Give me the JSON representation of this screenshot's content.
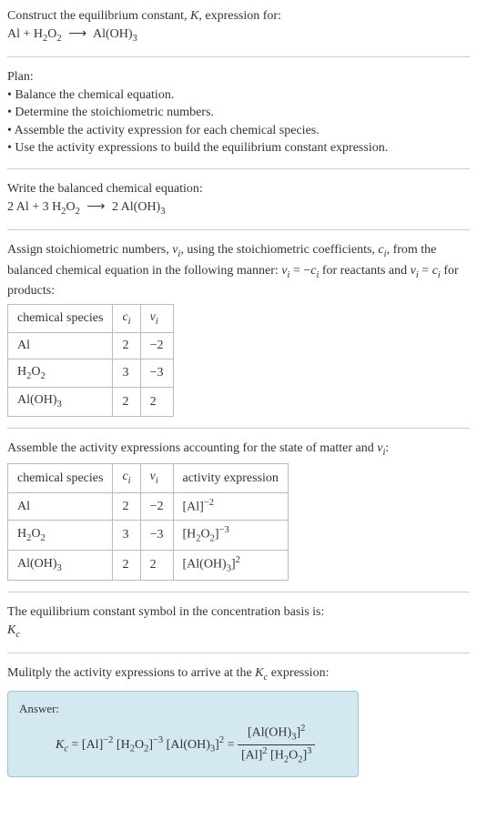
{
  "intro": {
    "line1": "Construct the equilibrium constant, ",
    "K": "K",
    "line1b": ", expression for:",
    "equation_lhs": "Al + H",
    "equation_sub1": "2",
    "equation_mid": "O",
    "equation_sub2": "2",
    "arrow": "⟶",
    "equation_rhs": "Al(OH)",
    "equation_sub3": "3"
  },
  "plan": {
    "title": "Plan:",
    "b1": "• Balance the chemical equation.",
    "b2": "• Determine the stoichiometric numbers.",
    "b3": "• Assemble the activity expression for each chemical species.",
    "b4": "• Use the activity expressions to build the equilibrium constant expression."
  },
  "balanced": {
    "title": "Write the balanced chemical equation:",
    "c1": "2 Al + 3 H",
    "s1": "2",
    "c2": "O",
    "s2": "2",
    "arrow": "⟶",
    "c3": "2 Al(OH)",
    "s3": "3"
  },
  "stoich": {
    "p1": "Assign stoichiometric numbers, ",
    "nu_i": "ν",
    "sub_i": "i",
    "p2": ", using the stoichiometric coefficients, ",
    "c_i": "c",
    "p3": ", from the balanced chemical equation in the following manner: ",
    "eq1a": "ν",
    "eq1b": " = −",
    "eq1c": "c",
    "p4": " for reactants and ",
    "eq2a": "ν",
    "eq2b": " = ",
    "eq2c": "c",
    "p5": " for products:",
    "table": {
      "h1": "chemical species",
      "h2": "c",
      "h2sub": "i",
      "h3": "ν",
      "h3sub": "i",
      "r1c1": "Al",
      "r1c2": "2",
      "r1c3": "−2",
      "r2c1a": "H",
      "r2c1s1": "2",
      "r2c1b": "O",
      "r2c1s2": "2",
      "r2c2": "3",
      "r2c3": "−3",
      "r3c1a": "Al(OH)",
      "r3c1s": "3",
      "r3c2": "2",
      "r3c3": "2"
    }
  },
  "activity": {
    "title": "Assemble the activity expressions accounting for the state of matter and ",
    "nu": "ν",
    "sub": "i",
    "colon": ":",
    "table": {
      "h1": "chemical species",
      "h2": "c",
      "h2sub": "i",
      "h3": "ν",
      "h3sub": "i",
      "h4": "activity expression",
      "r1c1": "Al",
      "r1c2": "2",
      "r1c3": "−2",
      "r1c4a": "[Al]",
      "r1c4sup": "−2",
      "r2c1a": "H",
      "r2c1s1": "2",
      "r2c1b": "O",
      "r2c1s2": "2",
      "r2c2": "3",
      "r2c3": "−3",
      "r2c4a": "[H",
      "r2c4s1": "2",
      "r2c4b": "O",
      "r2c4s2": "2",
      "r2c4c": "]",
      "r2c4sup": "−3",
      "r3c1a": "Al(OH)",
      "r3c1s": "3",
      "r3c2": "2",
      "r3c3": "2",
      "r3c4a": "[Al(OH)",
      "r3c4s": "3",
      "r3c4b": "]",
      "r3c4sup": "2"
    }
  },
  "symbol": {
    "line": "The equilibrium constant symbol in the concentration basis is:",
    "K": "K",
    "sub": "c"
  },
  "multiply": {
    "line1": "Mulitply the activity expressions to arrive at the ",
    "K": "K",
    "sub": "c",
    "line2": " expression:"
  },
  "answer": {
    "label": "Answer:",
    "K": "K",
    "Ksub": "c",
    "eq": " = [Al]",
    "sup1": "−2",
    "t2": " [H",
    "s2a": "2",
    "t2b": "O",
    "s2b": "2",
    "t2c": "]",
    "sup2": "−3",
    "t3": " [Al(OH)",
    "s3": "3",
    "t3b": "]",
    "sup3": "2",
    "eq2": " = ",
    "num1": "[Al(OH)",
    "nums1": "3",
    "num2": "]",
    "numsup": "2",
    "den1": "[Al]",
    "densup1": "2",
    "den2": " [H",
    "dens2a": "2",
    "den2b": "O",
    "dens2b": "2",
    "den2c": "]",
    "densup2": "3"
  }
}
